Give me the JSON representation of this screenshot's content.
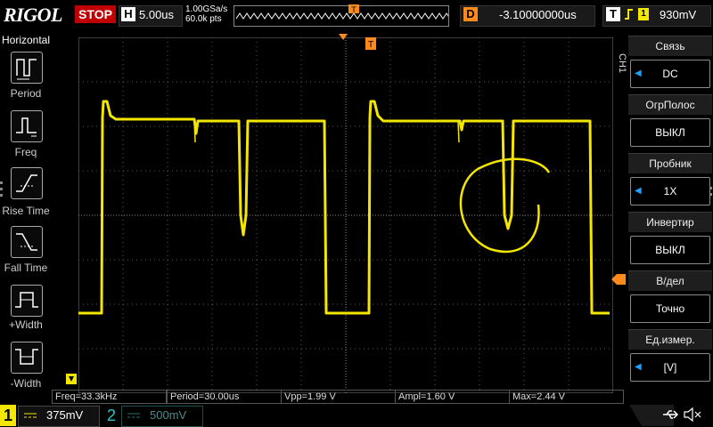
{
  "topbar": {
    "logo": "RIGOL",
    "run_state": "STOP",
    "timebase_letter": "H",
    "timebase": "5.00us",
    "sample_rate": "1.00GSa/s",
    "memory_depth": "60.0k pts",
    "delay_letter": "D",
    "delay": "-3.10000000us",
    "trigger_letter": "T",
    "trigger_level": "930mV"
  },
  "left_panel": {
    "title": "Horizontal",
    "items": [
      {
        "label": "Period"
      },
      {
        "label": "Freq"
      },
      {
        "label": "Rise Time"
      },
      {
        "label": "Fall Time"
      },
      {
        "label": "+Width"
      },
      {
        "label": "-Width"
      }
    ]
  },
  "right_panel": {
    "channel_label": "CH1",
    "items": [
      {
        "title": "Связь",
        "value": "DC",
        "arrow": true
      },
      {
        "title": "ОгрПолос",
        "value": "ВЫКЛ",
        "arrow": false
      },
      {
        "title": "Пробник",
        "value": "1X",
        "arrow": true
      },
      {
        "title": "Инвертир",
        "value": "ВЫКЛ",
        "arrow": false
      },
      {
        "title": "В/дел",
        "value": "Точно",
        "arrow": false
      },
      {
        "title": "Ед.измер.",
        "value": "[V]",
        "arrow": true
      }
    ]
  },
  "measurements": [
    {
      "text": "Freq=33.3kHz"
    },
    {
      "text": "Period=30.00us"
    },
    {
      "text": "Vpp=1.99 V"
    },
    {
      "text": "Ampl=1.60 V"
    },
    {
      "text": "Max=2.44 V"
    }
  ],
  "status": {
    "ch1_num": "1",
    "ch1_scale": "375mV",
    "ch2_num": "2",
    "ch2_scale": "500mV"
  },
  "colors": {
    "ch1": "#f5e600",
    "trigger": "#ff8a1c",
    "accent": "#1ea0ff",
    "stop": "#c00000"
  },
  "trigger_marker": "T"
}
